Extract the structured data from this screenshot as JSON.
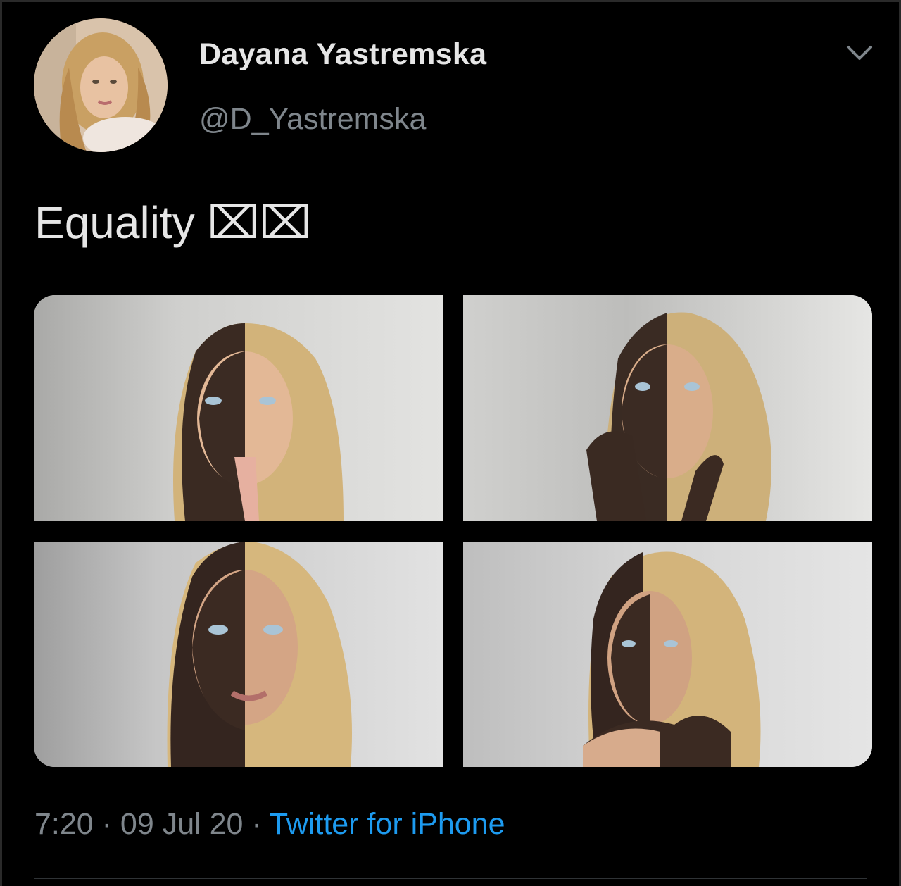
{
  "tweet": {
    "display_name": "Dayana Yastremska",
    "handle": "@D_Yastremska",
    "text": "Equality ⌧⌧",
    "time": "7:20",
    "separator": " · ",
    "date": "09 Jul 20",
    "source": "Twitter for iPhone",
    "media_count": 4
  },
  "icons": {
    "avatar": "profile-photo",
    "menu": "chevron-down-icon"
  },
  "colors": {
    "background": "#000000",
    "primary_text": "#e6e6e6",
    "secondary_text": "#7f868c",
    "link": "#1d9bf0"
  }
}
